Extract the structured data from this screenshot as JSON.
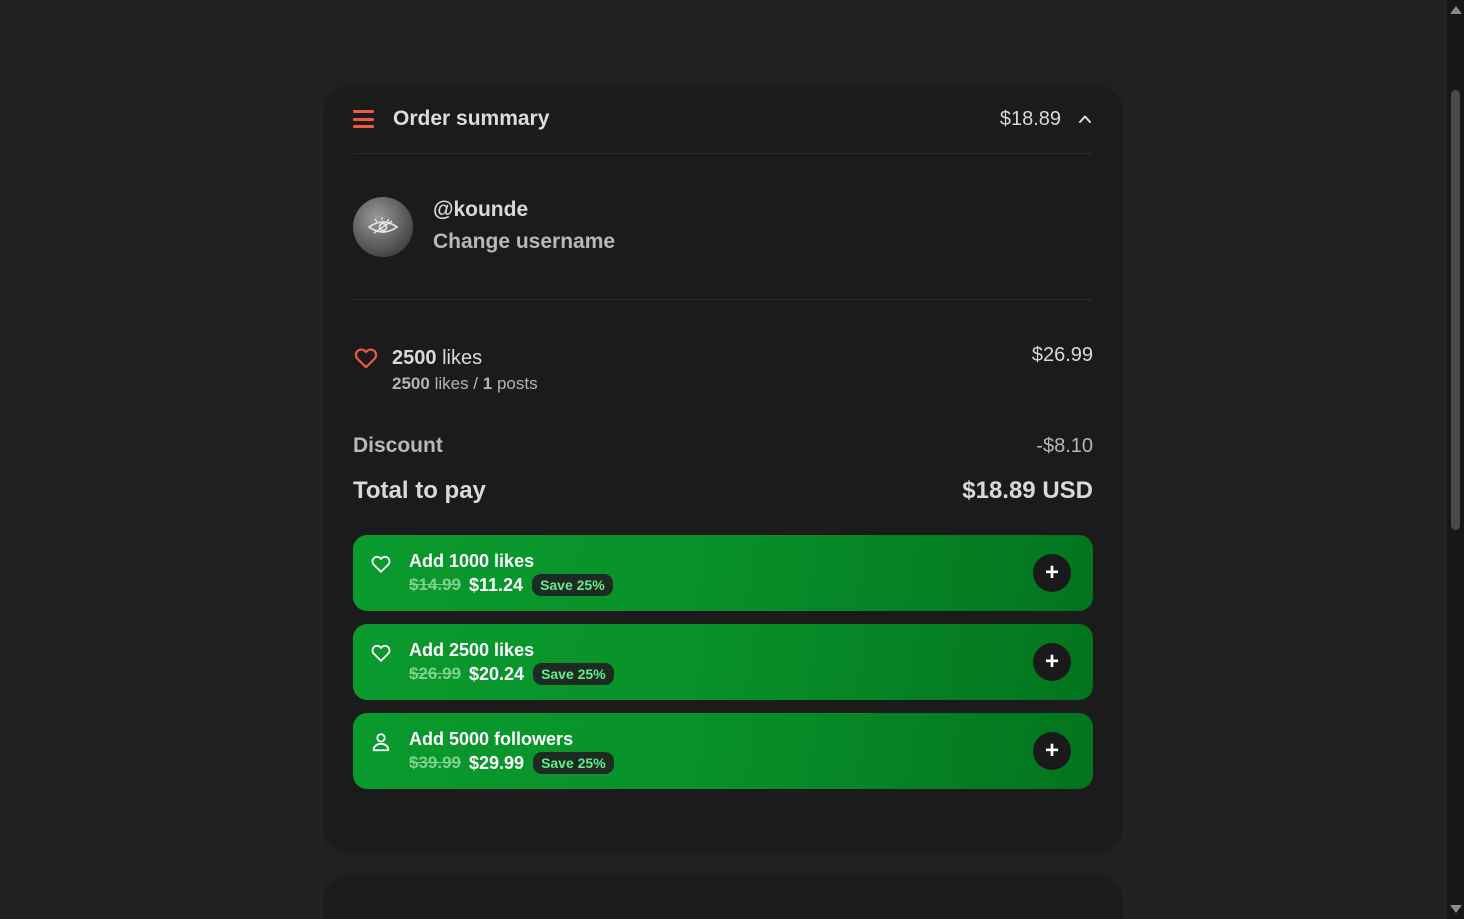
{
  "summary": {
    "title": "Order summary",
    "total": "$18.89",
    "menu_icon": "hamburger-icon",
    "toggle_icon": "chevron-up-icon"
  },
  "user": {
    "username": "@kounde",
    "change_label": "Change username"
  },
  "item": {
    "icon": "heart-icon",
    "qty": "2500",
    "unit": "likes",
    "sub_qty": "2500",
    "sub_unit": "likes /",
    "sub_posts_qty": "1",
    "sub_posts_unit": "posts",
    "price": "$26.99"
  },
  "discount": {
    "label": "Discount",
    "value": "-$8.10"
  },
  "total": {
    "label": "Total to pay",
    "value": "$18.89 USD"
  },
  "upsells": [
    {
      "icon": "heart-outline-icon",
      "prefix": "Add",
      "qty": "1000 likes",
      "old_price": "$14.99",
      "new_price": "$11.24",
      "badge": "Save 25%",
      "button": "+"
    },
    {
      "icon": "heart-outline-icon",
      "prefix": "Add",
      "qty": "2500 likes",
      "old_price": "$26.99",
      "new_price": "$20.24",
      "badge": "Save 25%",
      "button": "+"
    },
    {
      "icon": "user-icon",
      "prefix": "Add",
      "qty": "5000 followers",
      "old_price": "$39.99",
      "new_price": "$29.99",
      "badge": "Save 25%",
      "button": "+"
    }
  ],
  "colors": {
    "accent": "#ef5a45",
    "upsell_green": "#0a9a2e",
    "badge_text": "#5ff08a",
    "background": "#222222",
    "card": "#1b1b1b"
  }
}
